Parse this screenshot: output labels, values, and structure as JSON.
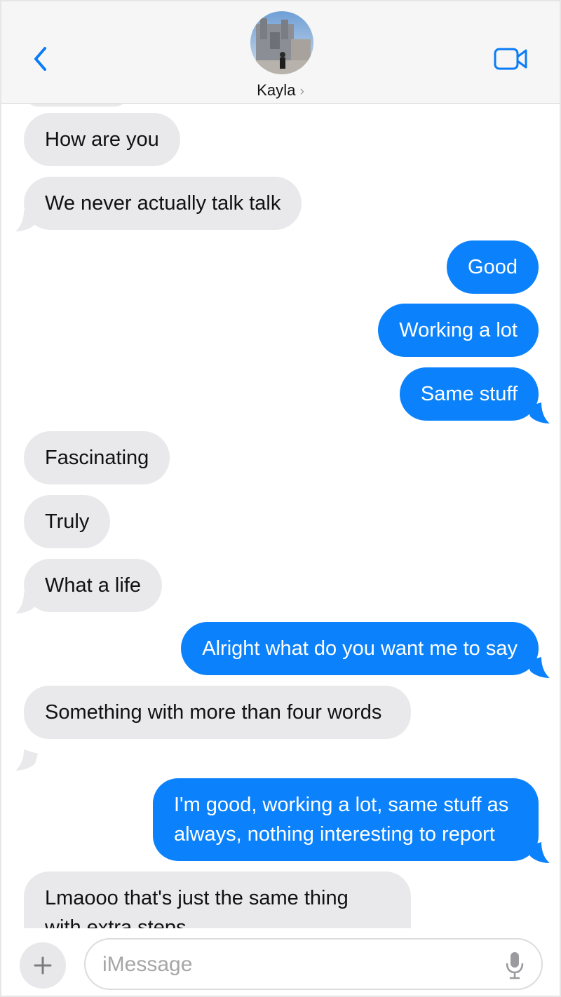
{
  "header": {
    "contact_name": "Kayla",
    "chevron": "›",
    "back_icon": "chevron-left-icon",
    "video_icon": "video-camera-icon"
  },
  "messages": [
    {
      "from": "them",
      "text": "How are you"
    },
    {
      "from": "them",
      "text": "We never actually talk talk"
    },
    {
      "from": "me",
      "text": "Good"
    },
    {
      "from": "me",
      "text": "Working a lot"
    },
    {
      "from": "me",
      "text": "Same stuff"
    },
    {
      "from": "them",
      "text": "Fascinating"
    },
    {
      "from": "them",
      "text": "Truly"
    },
    {
      "from": "them",
      "text": "What a life"
    },
    {
      "from": "me",
      "text": "Alright what do you want me to say"
    },
    {
      "from": "them",
      "text": "Something with more than four words"
    },
    {
      "from": "me",
      "text": "I'm good, working a lot, same stuff as always, nothing interesting to report"
    },
    {
      "from": "them",
      "text": "Lmaooo that's just the same thing with extra steps"
    }
  ],
  "input": {
    "placeholder": "iMessage",
    "value": "",
    "plus_label": "+",
    "mic_icon": "microphone-icon"
  },
  "colors": {
    "outgoing": "#0b82fb",
    "incoming": "#e9e9eb",
    "accent": "#0b7cf5",
    "header_bg": "#f6f6f6"
  }
}
